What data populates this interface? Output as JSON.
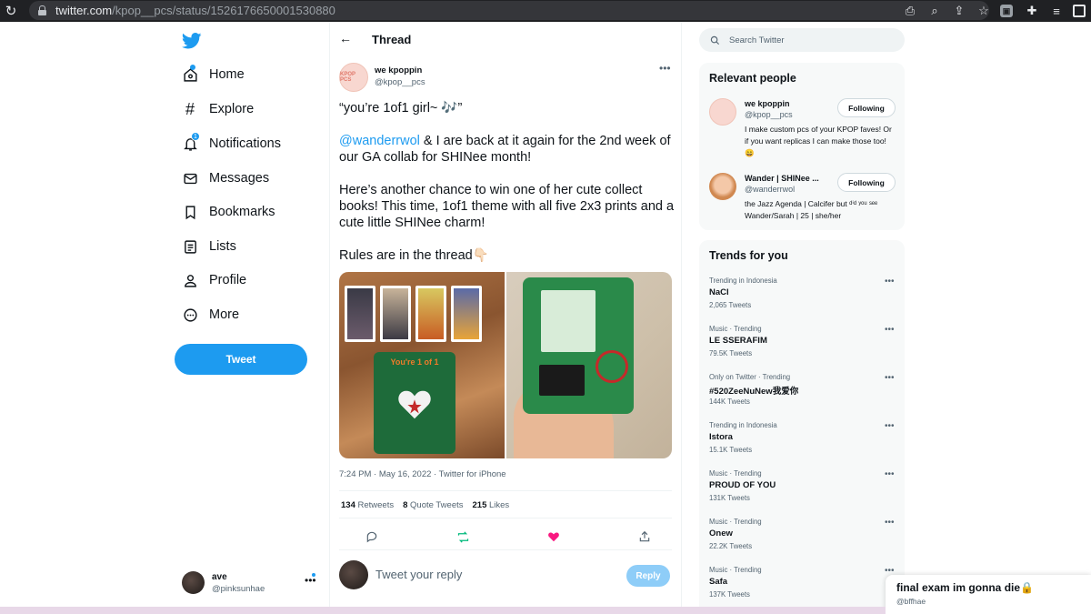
{
  "browser": {
    "url_host": "twitter.com",
    "url_path": "/kpop__pcs/status/1526176650001530880"
  },
  "sidebar": {
    "items": [
      {
        "label": "Home",
        "icon": "home-icon"
      },
      {
        "label": "Explore",
        "icon": "hashtag-icon"
      },
      {
        "label": "Notifications",
        "icon": "bell-icon",
        "badge": "1"
      },
      {
        "label": "Messages",
        "icon": "envelope-icon"
      },
      {
        "label": "Bookmarks",
        "icon": "bookmark-icon"
      },
      {
        "label": "Lists",
        "icon": "list-icon"
      },
      {
        "label": "Profile",
        "icon": "person-icon"
      },
      {
        "label": "More",
        "icon": "more-circle-icon"
      }
    ],
    "tweet_button": "Tweet",
    "account": {
      "name": "ave",
      "handle": "@pinksunhae"
    }
  },
  "thread": {
    "title": "Thread",
    "author": {
      "name": "we kpoppin",
      "handle": "@kpop__pcs",
      "avatar_text": "KPOP PCS"
    },
    "text": {
      "line1": "“you’re 1of1 girl~ 🎶”",
      "mention": "@wanderrwol",
      "line2_rest": " & I are back at it again for the 2nd week of our GA collab for SHINee month!",
      "line3": "Here’s another chance to win one of her cute collect books! This time, 1of1 theme with all five 2x3 prints and a cute little SHINee charm!",
      "line4": "Rules are in the thread👇🏻"
    },
    "media_text": {
      "binder_title": "You're 1 of 1"
    },
    "meta": "7:24 PM · May 16, 2022 · Twitter for iPhone",
    "stats": {
      "retweets_count": "134",
      "retweets_label": "Retweets",
      "quotes_count": "8",
      "quotes_label": "Quote Tweets",
      "likes_count": "215",
      "likes_label": "Likes"
    },
    "reply": {
      "placeholder": "Tweet your reply",
      "button": "Reply"
    }
  },
  "right": {
    "search_placeholder": "Search Twitter",
    "relevant": {
      "title": "Relevant people",
      "people": [
        {
          "name": "we kpoppin",
          "handle": "@kpop__pcs",
          "button": "Following",
          "bio": "I make custom pcs of your KPOP faves! Or if you want replicas I can make those too! 😄"
        },
        {
          "name": "Wander | SHINee ...",
          "handle": "@wanderrwol",
          "button": "Following",
          "bio": "the Jazz Agenda | Calcifer but ᵈⁱᵈ ʸᵒᵘ ˢᵉᵉ Wander/Sarah | 25 | she/her"
        }
      ]
    },
    "trends": {
      "title": "Trends for you",
      "items": [
        {
          "meta": "Trending in Indonesia",
          "name": "NaCl",
          "count": "2,065 Tweets"
        },
        {
          "meta": "Music · Trending",
          "name": "LE SSERAFIM",
          "count": "79.5K Tweets"
        },
        {
          "meta": "Only on Twitter · Trending",
          "name": "#520ZeeNuNew我爱你",
          "count": "144K Tweets"
        },
        {
          "meta": "Trending in Indonesia",
          "name": "Istora",
          "count": "15.1K Tweets"
        },
        {
          "meta": "Music · Trending",
          "name": "PROUD OF YOU",
          "count": "131K Tweets"
        },
        {
          "meta": "Music · Trending",
          "name": "Onew",
          "count": "22.2K Tweets"
        },
        {
          "meta": "Music · Trending",
          "name": "Safa",
          "count": "137K Tweets"
        }
      ]
    }
  },
  "toast": {
    "title": "final exam im gonna die🔒",
    "user": "@bffhae"
  },
  "colors": {
    "accent": "#1d9bf0",
    "like": "#f91880",
    "retweet": "#00ba7c"
  }
}
